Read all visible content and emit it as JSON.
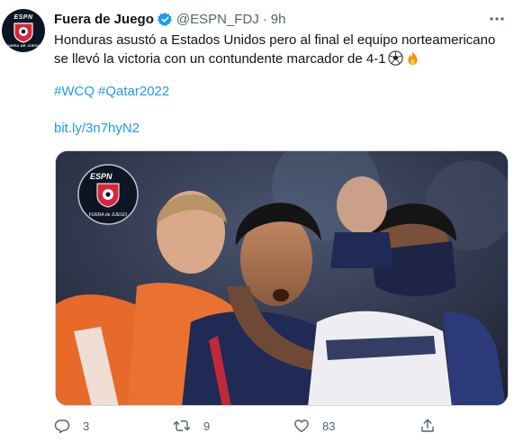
{
  "tweet": {
    "author_name": "Fuera de Juego",
    "author_handle": "@ESPN_FDJ",
    "separator": "·",
    "time": "9h",
    "text_line1": "Honduras asustó a Estados Unidos pero al final el equipo norteamericano",
    "text_line2": "se llevó la victoria con un contundente marcador de 4-1",
    "emojis": [
      "soccer-ball-icon",
      "fire-icon"
    ],
    "hashtags": [
      "#WCQ",
      "#Qatar2022"
    ],
    "link": "bit.ly/3n7hyN2",
    "media": {
      "watermark_top": "ESPN",
      "watermark_bottom": "FUERA de JUEGO"
    },
    "avatar": {
      "brand_top": "ESPN",
      "brand_sub": "FUERA DE JUEGO"
    },
    "actions": {
      "reply_count": "3",
      "retweet_count": "9",
      "like_count": "83",
      "share_count": ""
    }
  },
  "colors": {
    "text": "#0f1419",
    "secondary": "#536471",
    "link": "#1d9bf0",
    "verified": "#1d9bf0",
    "brand_red": "#d7263d"
  }
}
